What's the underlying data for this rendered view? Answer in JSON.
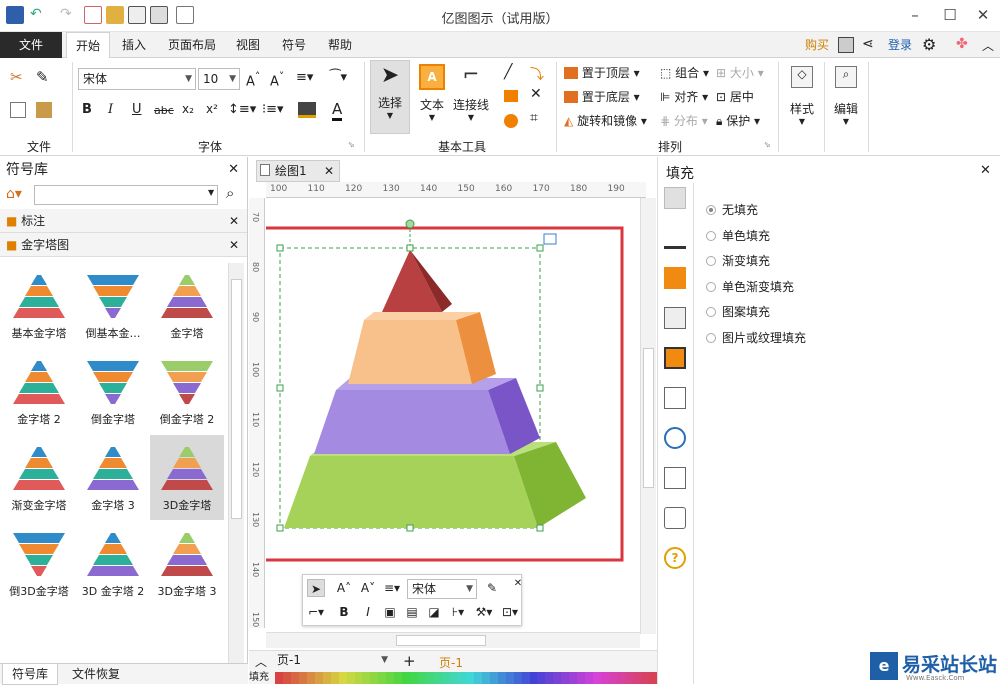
{
  "window": {
    "title": "亿图图示（试用版）"
  },
  "menu": {
    "file": "文件",
    "tabs": [
      "开始",
      "插入",
      "页面布局",
      "视图",
      "符号",
      "帮助"
    ],
    "right": {
      "buy": "购买",
      "login": "登录"
    }
  },
  "ribbon": {
    "groups": {
      "file": "文件",
      "font": "字体",
      "basic_tools": "基本工具",
      "arrange": "排列"
    },
    "font": {
      "family": "宋体",
      "size": "10"
    },
    "tools": {
      "select": "选择",
      "text": "文本",
      "connector": "连接线"
    },
    "arrange": {
      "to_top": "置于顶层",
      "to_bottom": "置于底层",
      "rotate_mirror": "旋转和镜像",
      "group": "组合",
      "align": "对齐",
      "distribute": "分布",
      "size": "大小",
      "center": "居中",
      "protect": "保护"
    },
    "style": "样式",
    "edit": "编辑"
  },
  "left_panel": {
    "title": "符号库",
    "search_placeholder": "",
    "sections": [
      "标注",
      "金字塔图"
    ],
    "shapes": [
      "基本金字塔",
      "倒基本金…",
      "金字塔",
      "金字塔 2",
      "倒金字塔",
      "倒金字塔 2",
      "渐变金字塔",
      "金字塔 3",
      "3D金字塔",
      "倒3D金字塔",
      "3D 金字塔 2",
      "3D金字塔 3"
    ],
    "selected_shape": "3D金字塔",
    "bottom_tabs": [
      "符号库",
      "文件恢复"
    ]
  },
  "canvas": {
    "doc_tab": "绘图1",
    "ruler_h": [
      "100",
      "110",
      "120",
      "130",
      "140",
      "150",
      "160",
      "170",
      "180",
      "190"
    ],
    "ruler_v": [
      "70",
      "80",
      "90",
      "100",
      "110",
      "120",
      "130",
      "140",
      "150"
    ],
    "float_toolbar": {
      "font": "宋体"
    },
    "page_label": "页-1",
    "page_tab": "页-1",
    "fill_label": "填充"
  },
  "right_panel": {
    "title": "填充",
    "options": [
      "无填充",
      "单色填充",
      "渐变填充",
      "单色渐变填充",
      "图案填充",
      "图片或纹理填充"
    ],
    "selected": "无填充"
  },
  "watermark": {
    "text": "易采站长站",
    "sub": "Www.Easck.Com"
  },
  "colors": {
    "accent_red": "#d9363e",
    "pyramid_top": "#a83232",
    "pyramid_2": "#f0a060",
    "pyramid_3": "#8a63d2",
    "pyramid_4": "#8dc63f"
  }
}
